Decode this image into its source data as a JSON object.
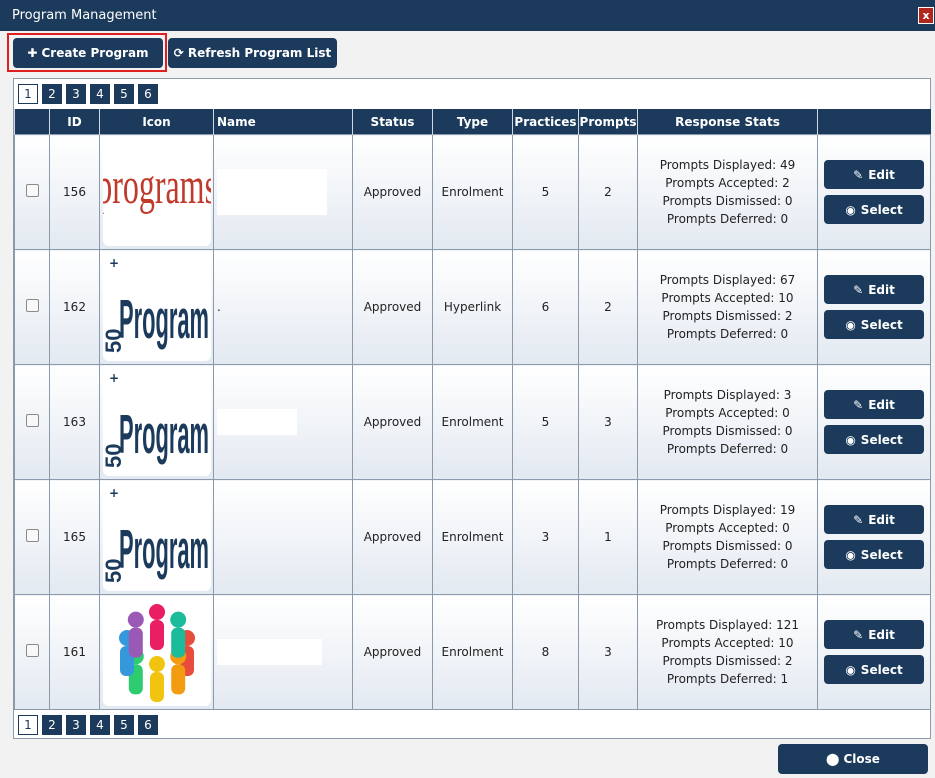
{
  "window": {
    "title": "Program Management",
    "close_label": "x"
  },
  "toolbar": {
    "create_label": "Create Program",
    "refresh_label": "Refresh Program List"
  },
  "pagination": {
    "pages": [
      "1",
      "2",
      "3",
      "4",
      "5",
      "6"
    ],
    "current": "1"
  },
  "table": {
    "headers": [
      "",
      "ID",
      "Icon",
      "Name",
      "Status",
      "Type",
      "Practices",
      "Prompts",
      "Response Stats",
      ""
    ],
    "rows": [
      {
        "id": "156",
        "icon": "programs-logo",
        "name": "",
        "status": "Approved",
        "type": "Enrolment",
        "practices": "5",
        "prompts": "2",
        "stats": [
          "Prompts Displayed: 49",
          "Prompts Accepted: 2",
          "Prompts Dismissed: 0",
          "Prompts Deferred: 0"
        ]
      },
      {
        "id": "162",
        "icon": "50-plus-program-logo",
        "name": ".",
        "status": "Approved",
        "type": "Hyperlink",
        "practices": "6",
        "prompts": "2",
        "stats": [
          "Prompts Displayed: 67",
          "Prompts Accepted: 10",
          "Prompts Dismissed: 2",
          "Prompts Deferred: 0"
        ]
      },
      {
        "id": "163",
        "icon": "50-plus-program-logo",
        "name": "",
        "status": "Approved",
        "type": "Enrolment",
        "practices": "5",
        "prompts": "3",
        "stats": [
          "Prompts Displayed: 3",
          "Prompts Accepted: 0",
          "Prompts Dismissed: 0",
          "Prompts Deferred: 0"
        ]
      },
      {
        "id": "165",
        "icon": "50-plus-program-logo",
        "name": "",
        "status": "Approved",
        "type": "Enrolment",
        "practices": "3",
        "prompts": "1",
        "stats": [
          "Prompts Displayed: 19",
          "Prompts Accepted: 0",
          "Prompts Dismissed: 0",
          "Prompts Deferred: 0"
        ]
      },
      {
        "id": "161",
        "icon": "people-circle-image",
        "name": "",
        "status": "Approved",
        "type": "Enrolment",
        "practices": "8",
        "prompts": "3",
        "stats": [
          "Prompts Displayed: 121",
          "Prompts Accepted: 10",
          "Prompts Dismissed: 2",
          "Prompts Deferred: 1"
        ]
      }
    ],
    "edit_label": "Edit",
    "select_label": "Select"
  },
  "footer": {
    "close_label": "Close"
  },
  "colors": {
    "primary": "#1b3a5c",
    "highlight": "#e02020"
  },
  "logo_text": {
    "programs": "programs",
    "fifty": "50",
    "plus": "+",
    "program": "Program"
  }
}
